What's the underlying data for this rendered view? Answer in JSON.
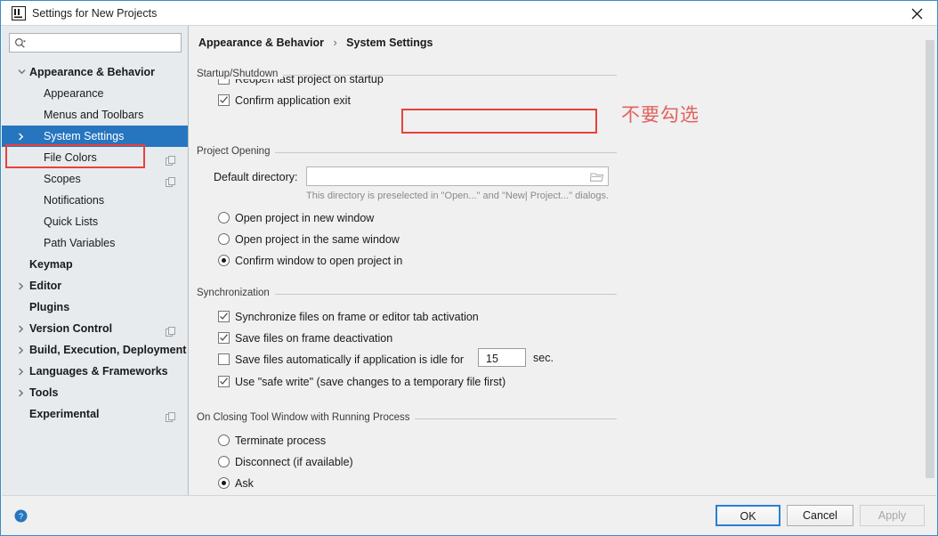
{
  "window": {
    "title": "Settings for New Projects",
    "app_icon": "intellij-idea-icon",
    "close_icon": "close-icon"
  },
  "sidebar": {
    "search": {
      "value": "",
      "placeholder": "",
      "icon": "search-icon"
    },
    "items": [
      {
        "label": "Appearance & Behavior",
        "level": 0,
        "bold": true,
        "arrow": "down",
        "selected": false,
        "copy_icon": false
      },
      {
        "label": "Appearance",
        "level": 1,
        "bold": false,
        "arrow": "none",
        "selected": false,
        "copy_icon": false
      },
      {
        "label": "Menus and Toolbars",
        "level": 1,
        "bold": false,
        "arrow": "none",
        "selected": false,
        "copy_icon": false
      },
      {
        "label": "System Settings",
        "level": 1,
        "bold": false,
        "arrow": "right",
        "selected": true,
        "copy_icon": false
      },
      {
        "label": "File Colors",
        "level": 1,
        "bold": false,
        "arrow": "none",
        "selected": false,
        "copy_icon": true
      },
      {
        "label": "Scopes",
        "level": 1,
        "bold": false,
        "arrow": "none",
        "selected": false,
        "copy_icon": true
      },
      {
        "label": "Notifications",
        "level": 1,
        "bold": false,
        "arrow": "none",
        "selected": false,
        "copy_icon": false
      },
      {
        "label": "Quick Lists",
        "level": 1,
        "bold": false,
        "arrow": "none",
        "selected": false,
        "copy_icon": false
      },
      {
        "label": "Path Variables",
        "level": 1,
        "bold": false,
        "arrow": "none",
        "selected": false,
        "copy_icon": false
      },
      {
        "label": "Keymap",
        "level": 0,
        "bold": true,
        "arrow": "none",
        "selected": false,
        "copy_icon": false
      },
      {
        "label": "Editor",
        "level": 0,
        "bold": true,
        "arrow": "right",
        "selected": false,
        "copy_icon": false
      },
      {
        "label": "Plugins",
        "level": 0,
        "bold": true,
        "arrow": "none",
        "selected": false,
        "copy_icon": false
      },
      {
        "label": "Version Control",
        "level": 0,
        "bold": true,
        "arrow": "right",
        "selected": false,
        "copy_icon": true
      },
      {
        "label": "Build, Execution, Deployment",
        "level": 0,
        "bold": true,
        "arrow": "right",
        "selected": false,
        "copy_icon": false
      },
      {
        "label": "Languages & Frameworks",
        "level": 0,
        "bold": true,
        "arrow": "right",
        "selected": false,
        "copy_icon": false
      },
      {
        "label": "Tools",
        "level": 0,
        "bold": true,
        "arrow": "right",
        "selected": false,
        "copy_icon": false
      },
      {
        "label": "Experimental",
        "level": 0,
        "bold": true,
        "arrow": "none",
        "selected": false,
        "copy_icon": true
      }
    ]
  },
  "breadcrumb": {
    "parent": "Appearance & Behavior",
    "separator": "›",
    "current": "System Settings"
  },
  "groups": {
    "startup": {
      "title": "Startup/Shutdown",
      "reopen_last_project": {
        "label": "Reopen last project on startup",
        "checked": false
      },
      "confirm_exit": {
        "label": "Confirm application exit",
        "checked": true
      }
    },
    "project_opening": {
      "title": "Project Opening",
      "default_directory_label": "Default directory:",
      "default_directory_value": "",
      "default_directory_placeholder": "",
      "browse_icon": "folder-icon",
      "hint": "This directory is preselected in \"Open...\" and \"New| Project...\" dialogs.",
      "options": [
        {
          "label": "Open project in new window",
          "selected": false
        },
        {
          "label": "Open project in the same window",
          "selected": false
        },
        {
          "label": "Confirm window to open project in",
          "selected": true
        }
      ]
    },
    "synchronization": {
      "title": "Synchronization",
      "checkboxes": [
        {
          "label": "Synchronize files on frame or editor tab activation",
          "checked": true
        },
        {
          "label": "Save files on frame deactivation",
          "checked": true
        },
        {
          "label": "Save files automatically if application is idle for",
          "checked": false
        },
        {
          "label": "Use \"safe write\" (save changes to a temporary file first)",
          "checked": true
        }
      ],
      "idle_seconds": "15",
      "idle_unit": "sec."
    },
    "closing_tool_window": {
      "title": "On Closing Tool Window with Running Process",
      "options": [
        {
          "label": "Terminate process",
          "selected": false
        },
        {
          "label": "Disconnect (if available)",
          "selected": false
        },
        {
          "label": "Ask",
          "selected": true
        }
      ]
    }
  },
  "annotations": {
    "chinese_note": "不要勾选",
    "note_color": "#e0625f",
    "highlight_color": "#e8413c"
  },
  "footer": {
    "help_icon": "help-icon",
    "ok": "OK",
    "cancel": "Cancel",
    "apply": "Apply",
    "apply_disabled": true
  }
}
